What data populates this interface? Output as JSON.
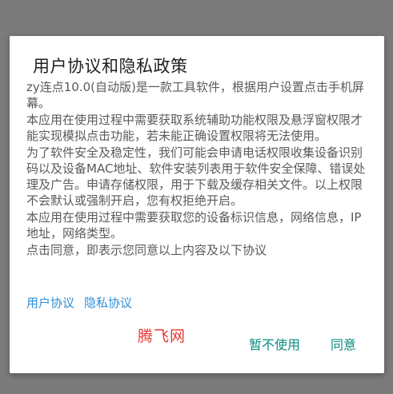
{
  "dialog": {
    "title": "用户协议和隐私政策",
    "paragraphs": [
      "zy连点10.0(自动版)是一款工具软件，根据用户设置点击手机屏幕。",
      "本应用在使用过程中需要获取系统辅助功能权限及悬浮窗权限才能实现模拟点击功能，若未能正确设置权限将无法使用。",
      "为了软件安全及稳定性，我们可能会申请电话权限收集设备识别码以及设备MAC地址、软件安装列表用于软件安全保障、错误处理及广告。申请存储权限，用于下载及缓存相关文件。以上权限不会默认或强制开启，您有权拒绝开启。",
      "本应用在使用过程中需要获取您的设备标识信息，网络信息，IP地址，网络类型。",
      "点击同意，即表示您同意以上内容及以下协议"
    ],
    "links": {
      "user_agreement": "用户协议",
      "privacy_policy": "隐私协议"
    },
    "buttons": {
      "decline": "暂不使用",
      "agree": "同意"
    }
  },
  "watermark": "腾飞网",
  "colors": {
    "link": "#2f8fd8",
    "button": "#0a8c7e",
    "watermark": "#e53935",
    "scrim": "#7b7b7b"
  }
}
